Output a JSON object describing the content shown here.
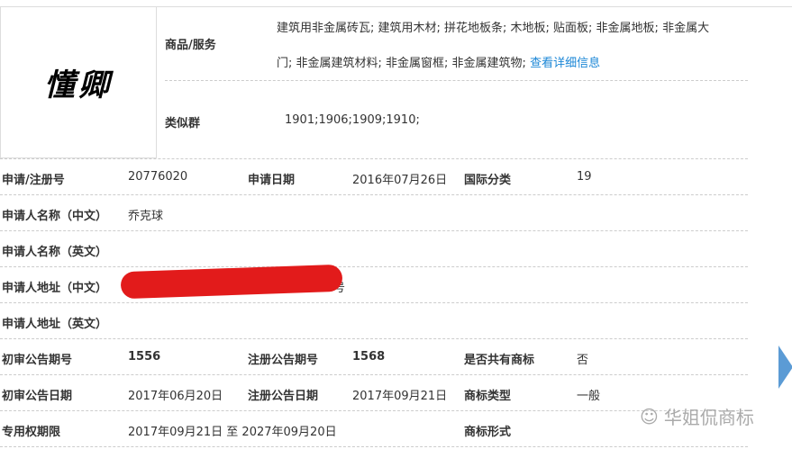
{
  "trademark": {
    "logo_text": "懂卿"
  },
  "goods": {
    "label": "商品/服务",
    "line1": "建筑用非金属砖瓦; 建筑用木材; 拼花地板条; 木地板; 贴面板; 非金属地板; 非金属大",
    "line2": "门; 非金属建筑材料; 非金属窗框; 非金属建筑物;",
    "detail_link": "查看详细信息"
  },
  "similar": {
    "label": "类似群",
    "value": "1901;1906;1909;1910;"
  },
  "rows": {
    "app_no_label": "申请/注册号",
    "app_no": "20776020",
    "app_date_label": "申请日期",
    "app_date": "2016年07月26日",
    "intl_class_label": "国际分类",
    "intl_class": "19",
    "applicant_cn_label": "申请人名称（中文）",
    "applicant_cn": "乔克球",
    "applicant_en_label": "申请人名称（英文）",
    "address_cn_label": "申请人地址（中文）",
    "address_cn_tail": "号",
    "address_en_label": "申请人地址（英文）",
    "prelim_issue_label": "初审公告期号",
    "prelim_issue": "1556",
    "reg_issue_label": "注册公告期号",
    "reg_issue": "1568",
    "shared_label": "是否共有商标",
    "shared": "否",
    "prelim_date_label": "初审公告日期",
    "prelim_date": "2017年06月20日",
    "reg_date_label": "注册公告日期",
    "reg_date": "2017年09月21日",
    "type_label": "商标类型",
    "type": "一般",
    "term_label": "专用权期限",
    "term": "2017年09月21日 至 2027年09月20日",
    "form_label": "商标形式"
  },
  "watermark": "华姐侃商标",
  "colors": {
    "link": "#1a86d6",
    "redact": "#e21b1b",
    "chevron": "#5b9bd5"
  }
}
